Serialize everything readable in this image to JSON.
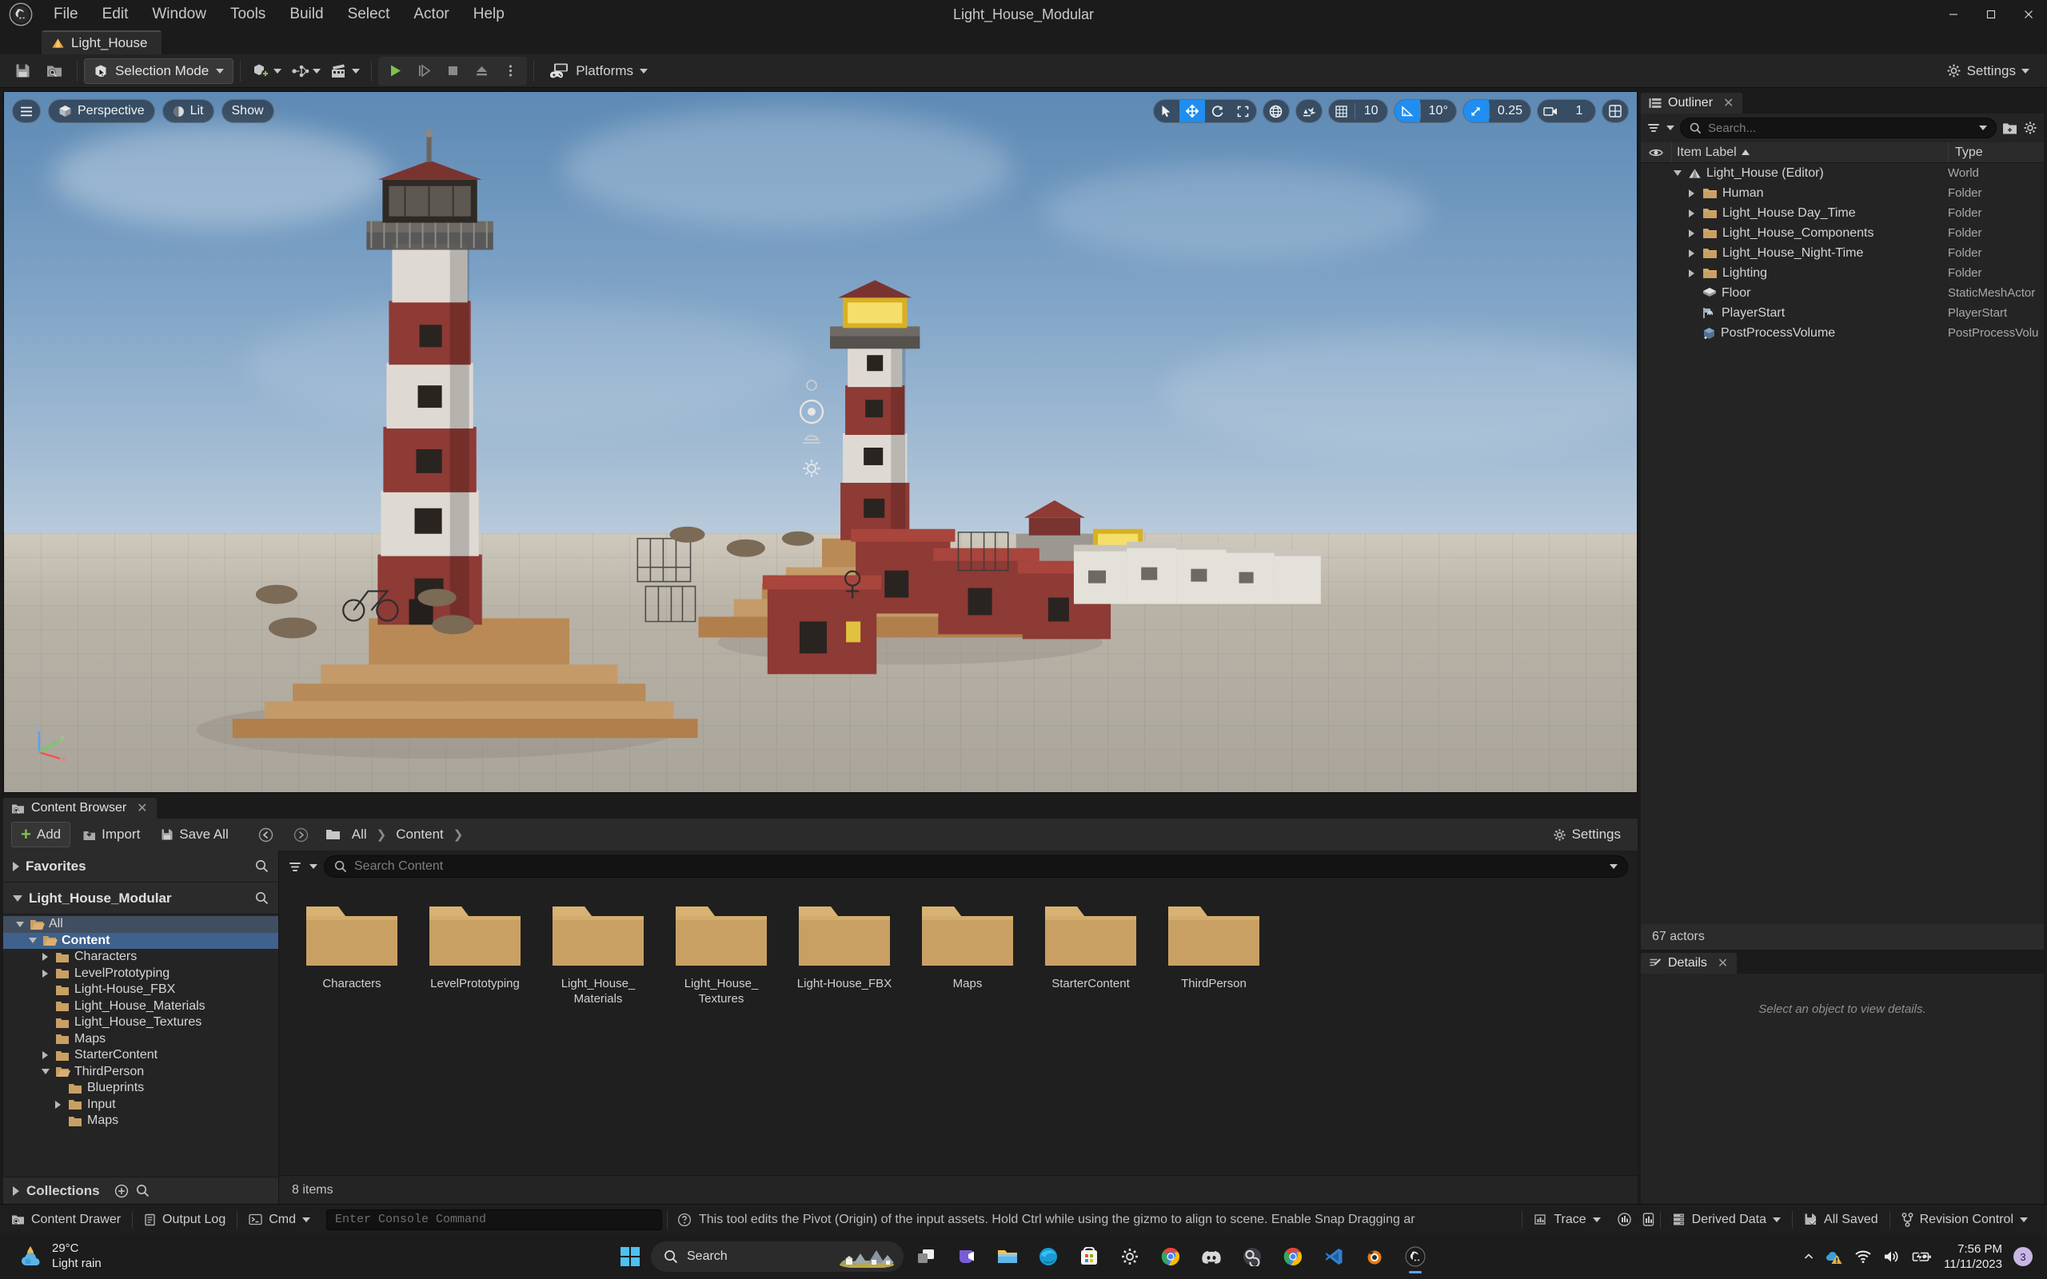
{
  "window": {
    "title": "Light_House_Modular",
    "minimize": "—",
    "maximize": "▢",
    "close": "✕"
  },
  "menubar": {
    "items": [
      {
        "label": "File"
      },
      {
        "label": "Edit"
      },
      {
        "label": "Window"
      },
      {
        "label": "Tools"
      },
      {
        "label": "Build"
      },
      {
        "label": "Select"
      },
      {
        "label": "Actor"
      },
      {
        "label": "Help"
      }
    ]
  },
  "level_tab": {
    "label": "Light_House"
  },
  "toolbar": {
    "save_tooltip": "Save",
    "browse_tooltip": "Browse",
    "mode_label": "Selection Mode",
    "platforms_label": "Platforms",
    "settings_label": "Settings",
    "play_tooltip": "Play",
    "skip_tooltip": "Skip",
    "stop_tooltip": "Stop",
    "eject_tooltip": "Eject",
    "more_tooltip": "More options"
  },
  "viewport": {
    "menu_tooltip": "Viewport Options",
    "perspective_label": "Perspective",
    "lit_label": "Lit",
    "show_label": "Show",
    "grid_snap_value": "10",
    "angle_snap_value": "10°",
    "scale_snap_value": "0.25",
    "camera_speed_value": "1",
    "axis_x": "x",
    "axis_y": "y",
    "axis_z": "z"
  },
  "outliner": {
    "tab_label": "Outliner",
    "search_placeholder": "Search...",
    "col_item_label": "Item Label",
    "col_type": "Type",
    "footer": "67 actors",
    "rows": [
      {
        "label": "Light_House (Editor)",
        "type": "World",
        "indent": 1,
        "icon": "level-icon",
        "expander": "down"
      },
      {
        "label": "Human",
        "type": "Folder",
        "indent": 2,
        "icon": "folder-icon",
        "expander": "right"
      },
      {
        "label": "Light_House Day_Time",
        "type": "Folder",
        "indent": 2,
        "icon": "folder-icon",
        "expander": "right"
      },
      {
        "label": "Light_House_Components",
        "type": "Folder",
        "indent": 2,
        "icon": "folder-icon",
        "expander": "right"
      },
      {
        "label": "Light_House_Night-Time",
        "type": "Folder",
        "indent": 2,
        "icon": "folder-icon",
        "expander": "right"
      },
      {
        "label": "Lighting",
        "type": "Folder",
        "indent": 2,
        "icon": "folder-icon",
        "expander": "right"
      },
      {
        "label": "Floor",
        "type": "StaticMeshActor",
        "indent": 2,
        "icon": "mesh-icon",
        "expander": "none"
      },
      {
        "label": "PlayerStart",
        "type": "PlayerStart",
        "indent": 2,
        "icon": "playerstart-icon",
        "expander": "none"
      },
      {
        "label": "PostProcessVolume",
        "type": "PostProcessVolu",
        "indent": 2,
        "icon": "volume-icon",
        "expander": "none"
      }
    ]
  },
  "details": {
    "tab_label": "Details",
    "empty_text": "Select an object to view details."
  },
  "content_browser": {
    "tab_label": "Content Browser",
    "add_label": "Add",
    "import_label": "Import",
    "save_all_label": "Save All",
    "settings_label": "Settings",
    "breadcrumbs": [
      "All",
      "Content"
    ],
    "search_placeholder": "Search Content",
    "favorites_label": "Favorites",
    "project_label": "Light_House_Modular",
    "collections_label": "Collections",
    "status": "8 items",
    "tree": [
      {
        "label": "All",
        "indent": 0,
        "expander": "down",
        "selected": false,
        "open": true
      },
      {
        "label": "Content",
        "indent": 1,
        "expander": "down",
        "selected": true,
        "open": true
      },
      {
        "label": "Characters",
        "indent": 2,
        "expander": "right",
        "selected": false,
        "open": false
      },
      {
        "label": "LevelPrototyping",
        "indent": 2,
        "expander": "right",
        "selected": false,
        "open": false
      },
      {
        "label": "Light-House_FBX",
        "indent": 2,
        "expander": "none",
        "selected": false,
        "open": false
      },
      {
        "label": "Light_House_Materials",
        "indent": 2,
        "expander": "none",
        "selected": false,
        "open": false
      },
      {
        "label": "Light_House_Textures",
        "indent": 2,
        "expander": "none",
        "selected": false,
        "open": false
      },
      {
        "label": "Maps",
        "indent": 2,
        "expander": "none",
        "selected": false,
        "open": false
      },
      {
        "label": "StarterContent",
        "indent": 2,
        "expander": "right",
        "selected": false,
        "open": false
      },
      {
        "label": "ThirdPerson",
        "indent": 2,
        "expander": "down",
        "selected": false,
        "open": true
      },
      {
        "label": "Blueprints",
        "indent": 3,
        "expander": "none",
        "selected": false,
        "open": false
      },
      {
        "label": "Input",
        "indent": 3,
        "expander": "right",
        "selected": false,
        "open": false
      },
      {
        "label": "Maps",
        "indent": 3,
        "expander": "none",
        "selected": false,
        "open": false
      }
    ],
    "assets": [
      {
        "label": "Characters"
      },
      {
        "label": "LevelPrototyping"
      },
      {
        "label": "Light_House_\nMaterials"
      },
      {
        "label": "Light_House_\nTextures"
      },
      {
        "label": "Light-House_FBX"
      },
      {
        "label": "Maps"
      },
      {
        "label": "StarterContent"
      },
      {
        "label": "ThirdPerson"
      }
    ]
  },
  "statusbar": {
    "content_drawer": "Content Drawer",
    "output_log": "Output Log",
    "cmd_label": "Cmd",
    "console_placeholder": "Enter Console Command",
    "tip": "This tool edits the Pivot (Origin) of the input assets. Hold Ctrl while using the gizmo to align to scene. Enable Snap Dragging ar",
    "trace_label": "Trace",
    "derived_data_label": "Derived Data",
    "all_saved_label": "All Saved",
    "revision_control_label": "Revision Control"
  },
  "taskbar": {
    "weather_temp": "29°C",
    "weather_desc": "Light rain",
    "search_placeholder": "Search",
    "time": "7:56 PM",
    "date": "11/11/2023",
    "notification_count": "3",
    "apps": [
      {
        "name": "task-view-icon"
      },
      {
        "name": "teams-icon"
      },
      {
        "name": "file-explorer-icon"
      },
      {
        "name": "edge-icon"
      },
      {
        "name": "microsoft-store-icon"
      },
      {
        "name": "chrome-icon"
      },
      {
        "name": "discord-icon"
      },
      {
        "name": "obs-icon"
      },
      {
        "name": "chrome2-icon"
      },
      {
        "name": "vscode-icon"
      },
      {
        "name": "blender-icon"
      },
      {
        "name": "unreal-icon"
      }
    ]
  },
  "colors": {
    "accent_blue": "#1f8ef0",
    "green": "#7ec24a",
    "folder": "#c9a063",
    "selection": "#3f618c"
  }
}
